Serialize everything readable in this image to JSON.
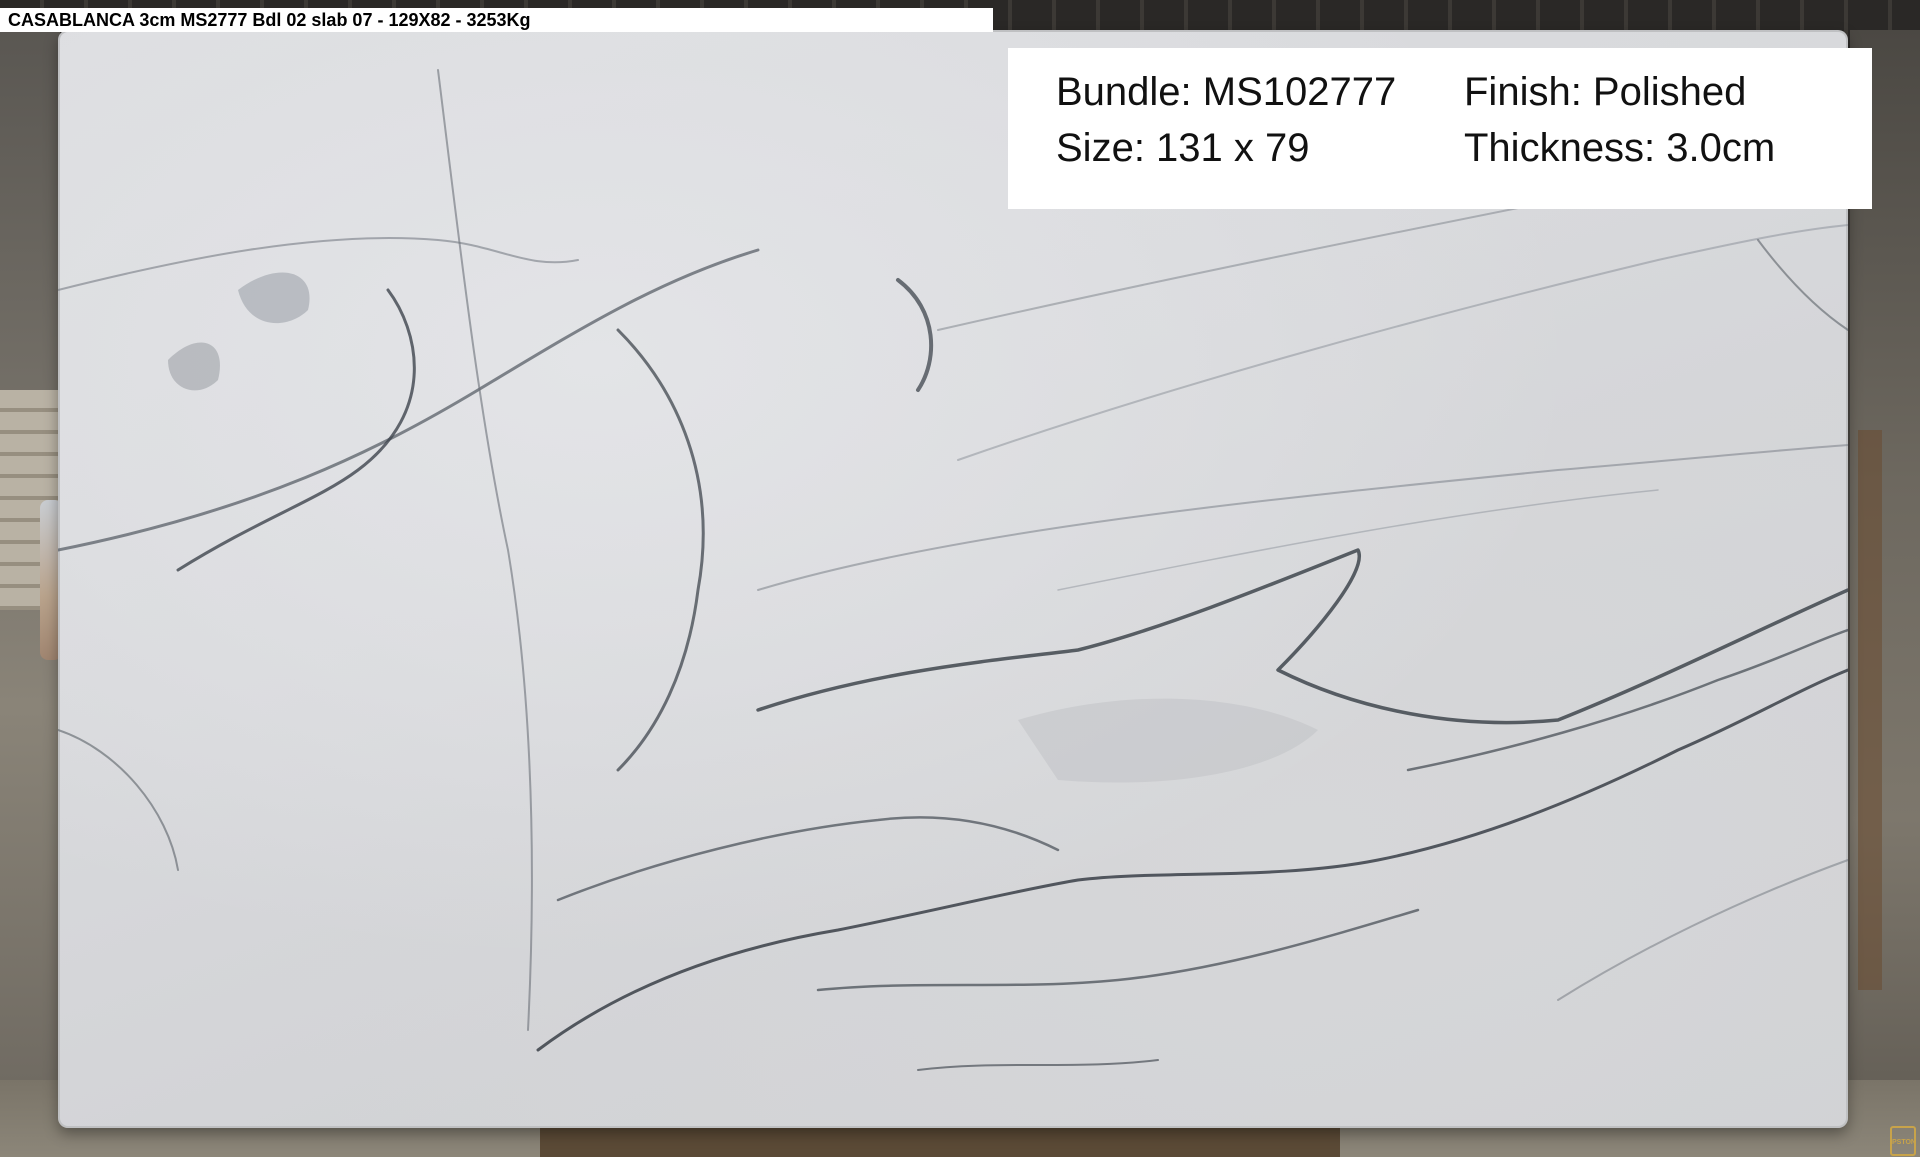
{
  "caption": {
    "text": "CASABLANCA 3cm MS2777 Bdl 02 slab 07 - 129X82 - 3253Kg"
  },
  "info_panel": {
    "bundle": "Bundle: MS102777",
    "size": "Size: 131 x 79",
    "finish": "Finish: Polished",
    "thickness": "Thickness: 3.0cm"
  },
  "watermark": {
    "text": "PSTONE"
  },
  "colors": {
    "slab_base": "#d8d9dc",
    "vein_dark": "#4a5058",
    "vein_light": "#8f959c",
    "panel_background": "#ffffff"
  }
}
